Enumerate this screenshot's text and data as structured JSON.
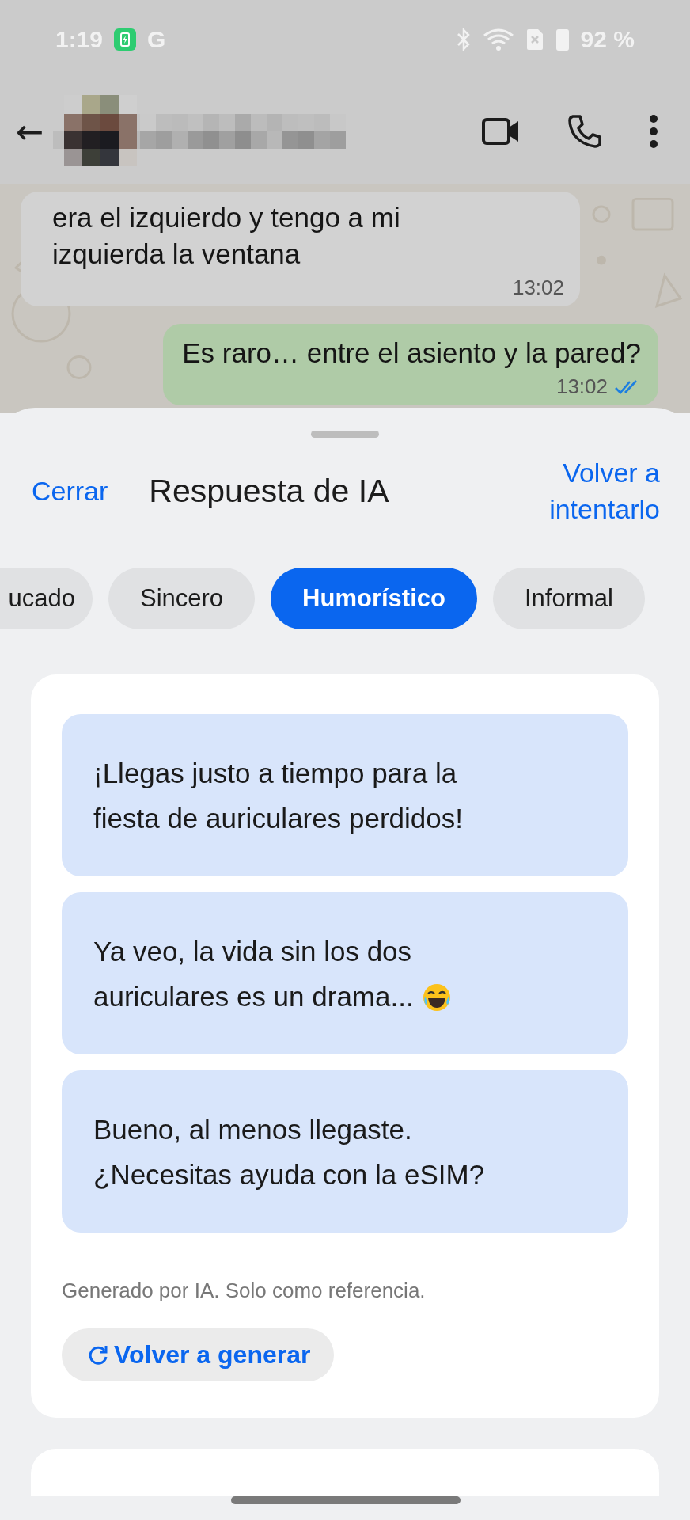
{
  "status_bar": {
    "time": "1:19",
    "carrier_glyph": "G",
    "battery": "92 %"
  },
  "chat_header": {
    "back": "←"
  },
  "messages": [
    {
      "kind": "incoming",
      "text": "era el izquierdo y tengo a mi izquierda la ventana",
      "time": "13:02"
    },
    {
      "kind": "outgoing",
      "text": "Es raro… entre el asiento y la pared?",
      "time": "13:02",
      "read": true
    }
  ],
  "sheet": {
    "close": "Cerrar",
    "title": "Respuesta de IA",
    "retry": "Volver a intentarlo",
    "tones": [
      {
        "label": "ucado",
        "selected": false,
        "cut": true
      },
      {
        "label": "Sincero",
        "selected": false,
        "cut": false
      },
      {
        "label": "Humorístico",
        "selected": true,
        "cut": false
      },
      {
        "label": "Informal",
        "selected": false,
        "cut": false
      }
    ],
    "suggestions": [
      {
        "text": "¡Llegas justo a tiempo para la fiesta de auriculares perdidos!",
        "kind": "plain"
      },
      {
        "text": "Ya veo, la vida sin los dos auriculares es un drama...",
        "kind": "emoji"
      },
      {
        "text": "Bueno, al menos llegaste. ¿Necesitas ayuda con la eSIM?",
        "kind": "plain"
      }
    ],
    "disclaimer": "Generado por IA. Solo como referencia.",
    "regenerate": "Volver a generar"
  }
}
